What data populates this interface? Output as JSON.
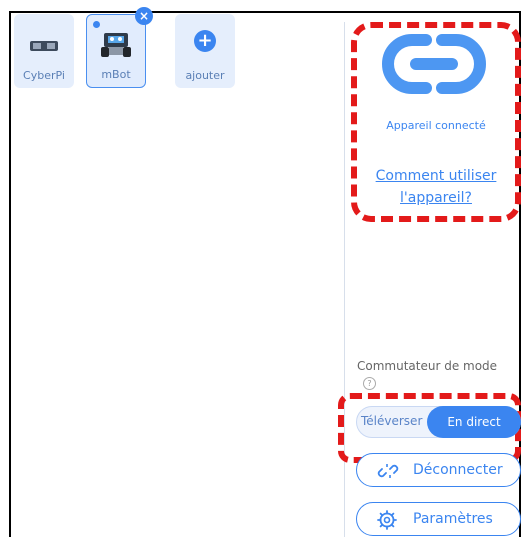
{
  "devices": [
    {
      "label": "CyberPi",
      "selected": false
    },
    {
      "label": "mBot",
      "selected": true
    },
    {
      "label": "ajouter",
      "selected": false
    }
  ],
  "close_badge": "×",
  "add_symbol": "+",
  "status": {
    "connected_label": "Appareil connecté",
    "icon": "link-icon"
  },
  "help_link": {
    "line1": "Comment utiliser",
    "line2": "l'appareil?"
  },
  "mode": {
    "title": "Commutateur de mode",
    "help_symbol": "?",
    "upload_label": "Téléverser",
    "live_label": "En direct",
    "active": "En direct"
  },
  "buttons": {
    "disconnect_label": "Déconnecter",
    "disconnect_icon": "unlink-icon",
    "settings_label": "Paramètres",
    "settings_icon": "gear-icon"
  },
  "colors": {
    "accent": "#3b85f0",
    "highlight_dash": "#e31a1a",
    "tile_bg": "#e5eefc"
  }
}
